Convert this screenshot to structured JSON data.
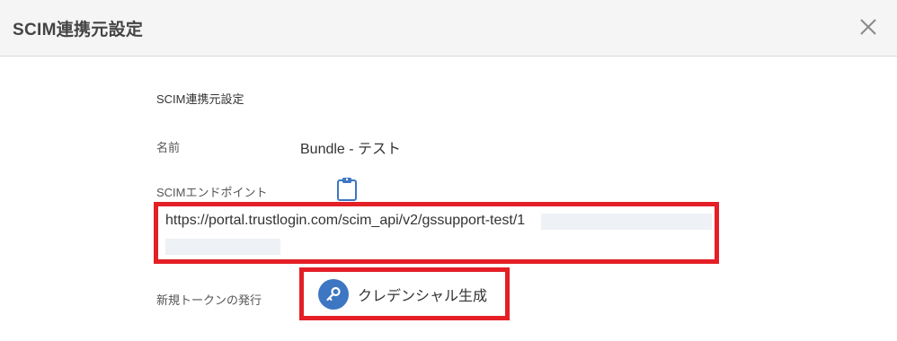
{
  "dialog": {
    "title": "SCIM連携元設定",
    "close_icon": "close-icon"
  },
  "form": {
    "section_title": "SCIM連携元設定",
    "name": {
      "label": "名前",
      "value": "Bundle - テスト"
    },
    "endpoint": {
      "label": "SCIMエンドポイント",
      "copy_icon": "clipboard-icon",
      "url": "https://portal.trustlogin.com/scim_api/v2/gssupport-test/1"
    },
    "token": {
      "label": "新規トークンの発行",
      "button_label": "クレデンシャル生成",
      "button_icon": "key-icon"
    }
  },
  "colors": {
    "highlight": "#e41f26",
    "accent": "#3d76c2",
    "header_bg": "#f5f5f5"
  }
}
